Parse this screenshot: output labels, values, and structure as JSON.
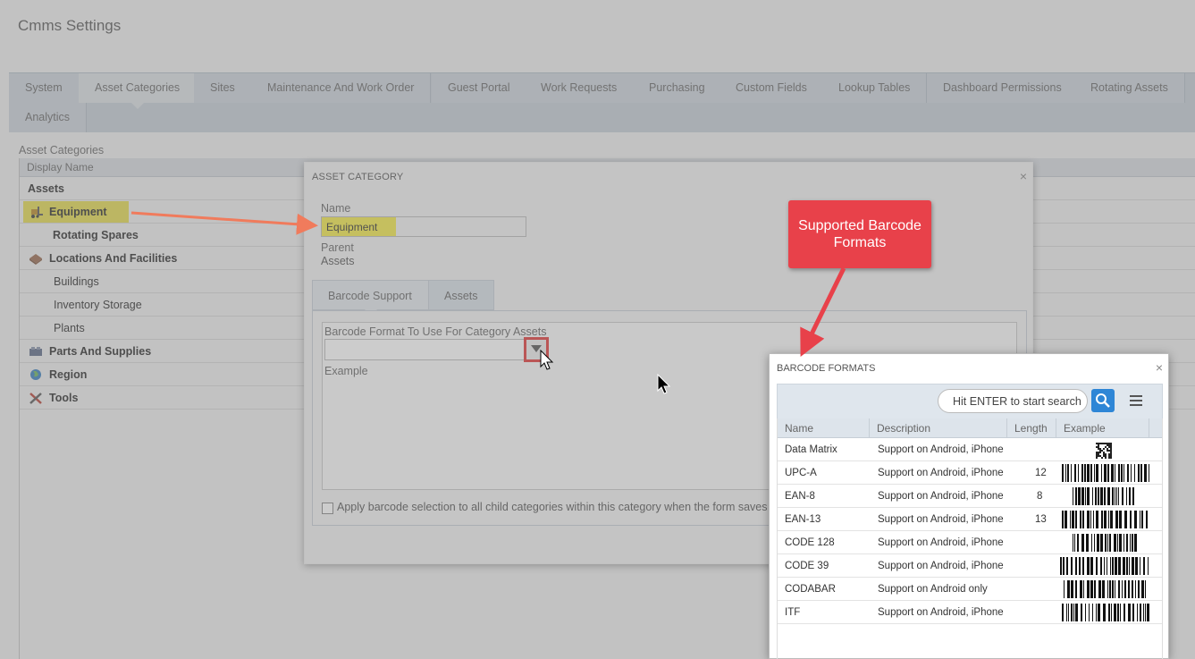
{
  "page": {
    "title": "Cmms Settings"
  },
  "tabs": [
    {
      "label": "System"
    },
    {
      "label": "Asset Categories"
    },
    {
      "label": "Sites"
    },
    {
      "label": "Maintenance And Work Order"
    },
    {
      "label": "Guest Portal"
    },
    {
      "label": "Work Requests"
    },
    {
      "label": "Purchasing"
    },
    {
      "label": "Custom Fields"
    },
    {
      "label": "Lookup Tables"
    },
    {
      "label": "Dashboard Permissions"
    },
    {
      "label": "Rotating Assets"
    },
    {
      "label": "Analytics"
    }
  ],
  "active_tab": "Asset Categories",
  "categories_panel": {
    "section_label": "Asset Categories",
    "column_header": "Display Name",
    "rows": [
      {
        "label": "Assets",
        "level": 0,
        "bold": true,
        "icon": ""
      },
      {
        "label": "Equipment",
        "level": 1,
        "bold": true,
        "icon": "forklift-icon",
        "highlighted": true
      },
      {
        "label": "Rotating Spares",
        "level": 2,
        "bold": true,
        "icon": ""
      },
      {
        "label": "Locations And Facilities",
        "level": 1,
        "bold": true,
        "icon": "building-icon"
      },
      {
        "label": "Buildings",
        "level": 2,
        "bold": false,
        "icon": ""
      },
      {
        "label": "Inventory Storage",
        "level": 2,
        "bold": false,
        "icon": ""
      },
      {
        "label": "Plants",
        "level": 2,
        "bold": false,
        "icon": ""
      },
      {
        "label": "Parts And Supplies",
        "level": 1,
        "bold": true,
        "icon": "parts-icon"
      },
      {
        "label": "Region",
        "level": 1,
        "bold": true,
        "icon": "globe-icon"
      },
      {
        "label": "Tools",
        "level": 1,
        "bold": true,
        "icon": "tools-icon"
      }
    ]
  },
  "asset_category_dialog": {
    "title": "ASSET CATEGORY",
    "name_label": "Name",
    "name_value": "Equipment",
    "parent_label": "Parent",
    "parent_value": "Assets",
    "tabs": [
      {
        "label": "Barcode Support"
      },
      {
        "label": "Assets"
      }
    ],
    "barcode_format_label": "Barcode Format To Use For Category Assets",
    "barcode_format_value": "",
    "example_label": "Example",
    "apply_checkbox_label": "Apply barcode selection to all child categories within this category when the form saves",
    "apply_checked": false
  },
  "callout": {
    "text": "Supported Barcode Formats"
  },
  "barcode_formats_dialog": {
    "title": "BARCODE FORMATS",
    "search_placeholder": "Hit ENTER to start search",
    "columns": [
      "Name",
      "Description",
      "Length",
      "Example"
    ],
    "rows": [
      {
        "name": "Data Matrix",
        "description": "Support on Android, iPhone",
        "length": "",
        "example": "datamatrix-image"
      },
      {
        "name": "UPC-A",
        "description": "Support on Android, iPhone",
        "length": "12",
        "example": "barcode-image"
      },
      {
        "name": "EAN-8",
        "description": "Support on Android, iPhone",
        "length": "8",
        "example": "barcode-image"
      },
      {
        "name": "EAN-13",
        "description": "Support on Android, iPhone",
        "length": "13",
        "example": "barcode-image"
      },
      {
        "name": "CODE 128",
        "description": "Support on Android, iPhone",
        "length": "",
        "example": "barcode-image"
      },
      {
        "name": "CODE 39",
        "description": "Support on Android, iPhone",
        "length": "",
        "example": "barcode-image"
      },
      {
        "name": "CODABAR",
        "description": "Support on Android only",
        "length": "",
        "example": "barcode-image"
      },
      {
        "name": "ITF",
        "description": "Support on Android, iPhone",
        "length": "",
        "example": "barcode-image"
      }
    ]
  },
  "colors": {
    "highlight": "#f3e94a",
    "callout": "#e8414a",
    "arrow_equipment": "#f07b5c",
    "arrow_callout": "#e8414a",
    "focus_outline": "#e23b3b",
    "search_button": "#2e86d6"
  }
}
